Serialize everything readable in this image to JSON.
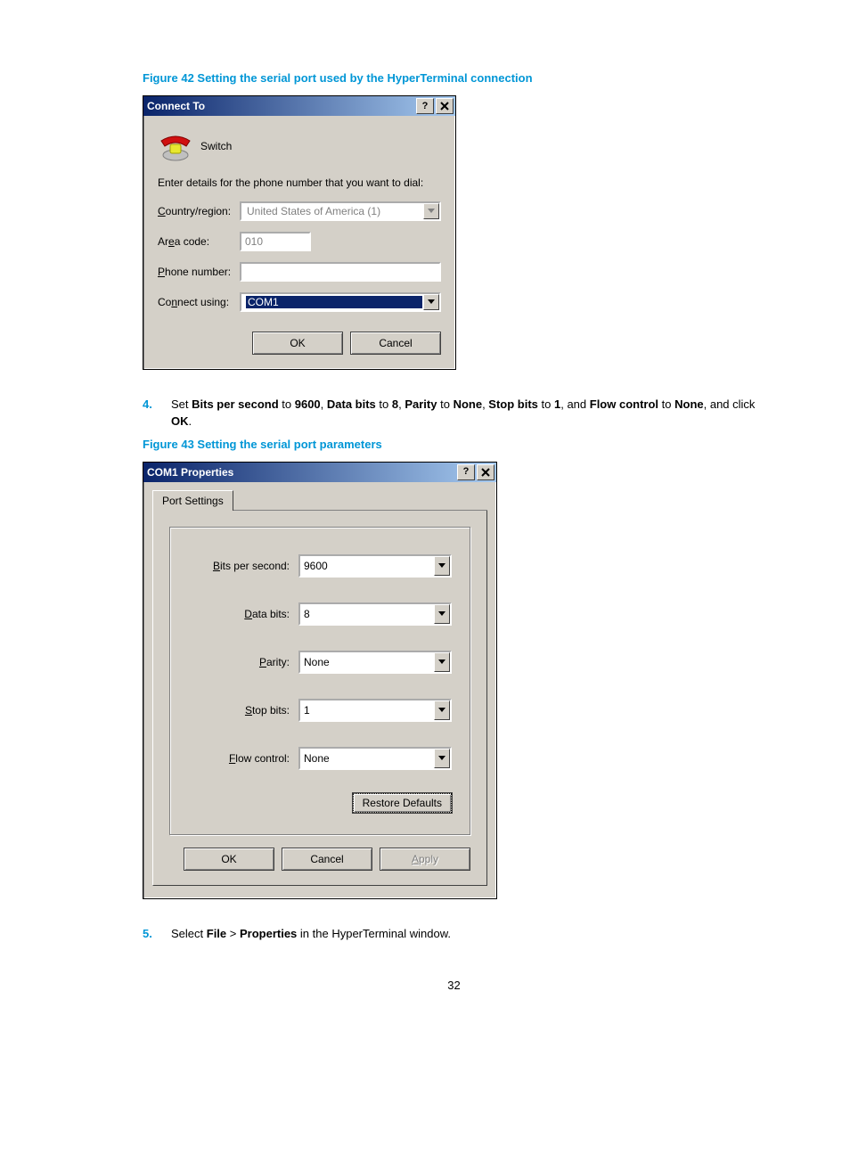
{
  "caption1": "Figure 42 Setting the serial port used by the HyperTerminal connection",
  "dialog1": {
    "title": "Connect To",
    "name": "Switch",
    "instruction": "Enter details for the phone number that you want to dial:",
    "labels": {
      "country": "Country/region:",
      "area": "Area code:",
      "phone": "Phone number:",
      "connect": "Connect using:"
    },
    "values": {
      "country": "United States of America (1)",
      "area": "010",
      "phone": "",
      "connect": "COM1"
    },
    "buttons": {
      "ok": "OK",
      "cancel": "Cancel"
    }
  },
  "step4": {
    "num": "4.",
    "pre": "Set ",
    "p1a": "Bits per second",
    "p1v": "9600",
    "p2a": "Data bits",
    "p2v": "8",
    "p3a": "Parity",
    "p3v": "None",
    "p4a": "Stop bits",
    "p4v": "1",
    "p5a": "Flow control",
    "p5v": "None",
    "tail": ", and click ",
    "ok": "OK",
    "dot": "."
  },
  "caption2": "Figure 43 Setting the serial port parameters",
  "dialog2": {
    "title": "COM1 Properties",
    "tab": "Port Settings",
    "rows": {
      "bps": {
        "label": "Bits per second:",
        "value": "9600"
      },
      "databits": {
        "label": "Data bits:",
        "value": "8"
      },
      "parity": {
        "label": "Parity:",
        "value": "None"
      },
      "stopbits": {
        "label": "Stop bits:",
        "value": "1"
      },
      "flow": {
        "label": "Flow control:",
        "value": "None"
      }
    },
    "restore": "Restore Defaults",
    "buttons": {
      "ok": "OK",
      "cancel": "Cancel",
      "apply": "Apply"
    }
  },
  "step5": {
    "num": "5.",
    "pre": "Select ",
    "file": "File",
    "gt": " > ",
    "props": "Properties",
    "tail": " in the HyperTerminal window."
  },
  "pagenum": "32"
}
